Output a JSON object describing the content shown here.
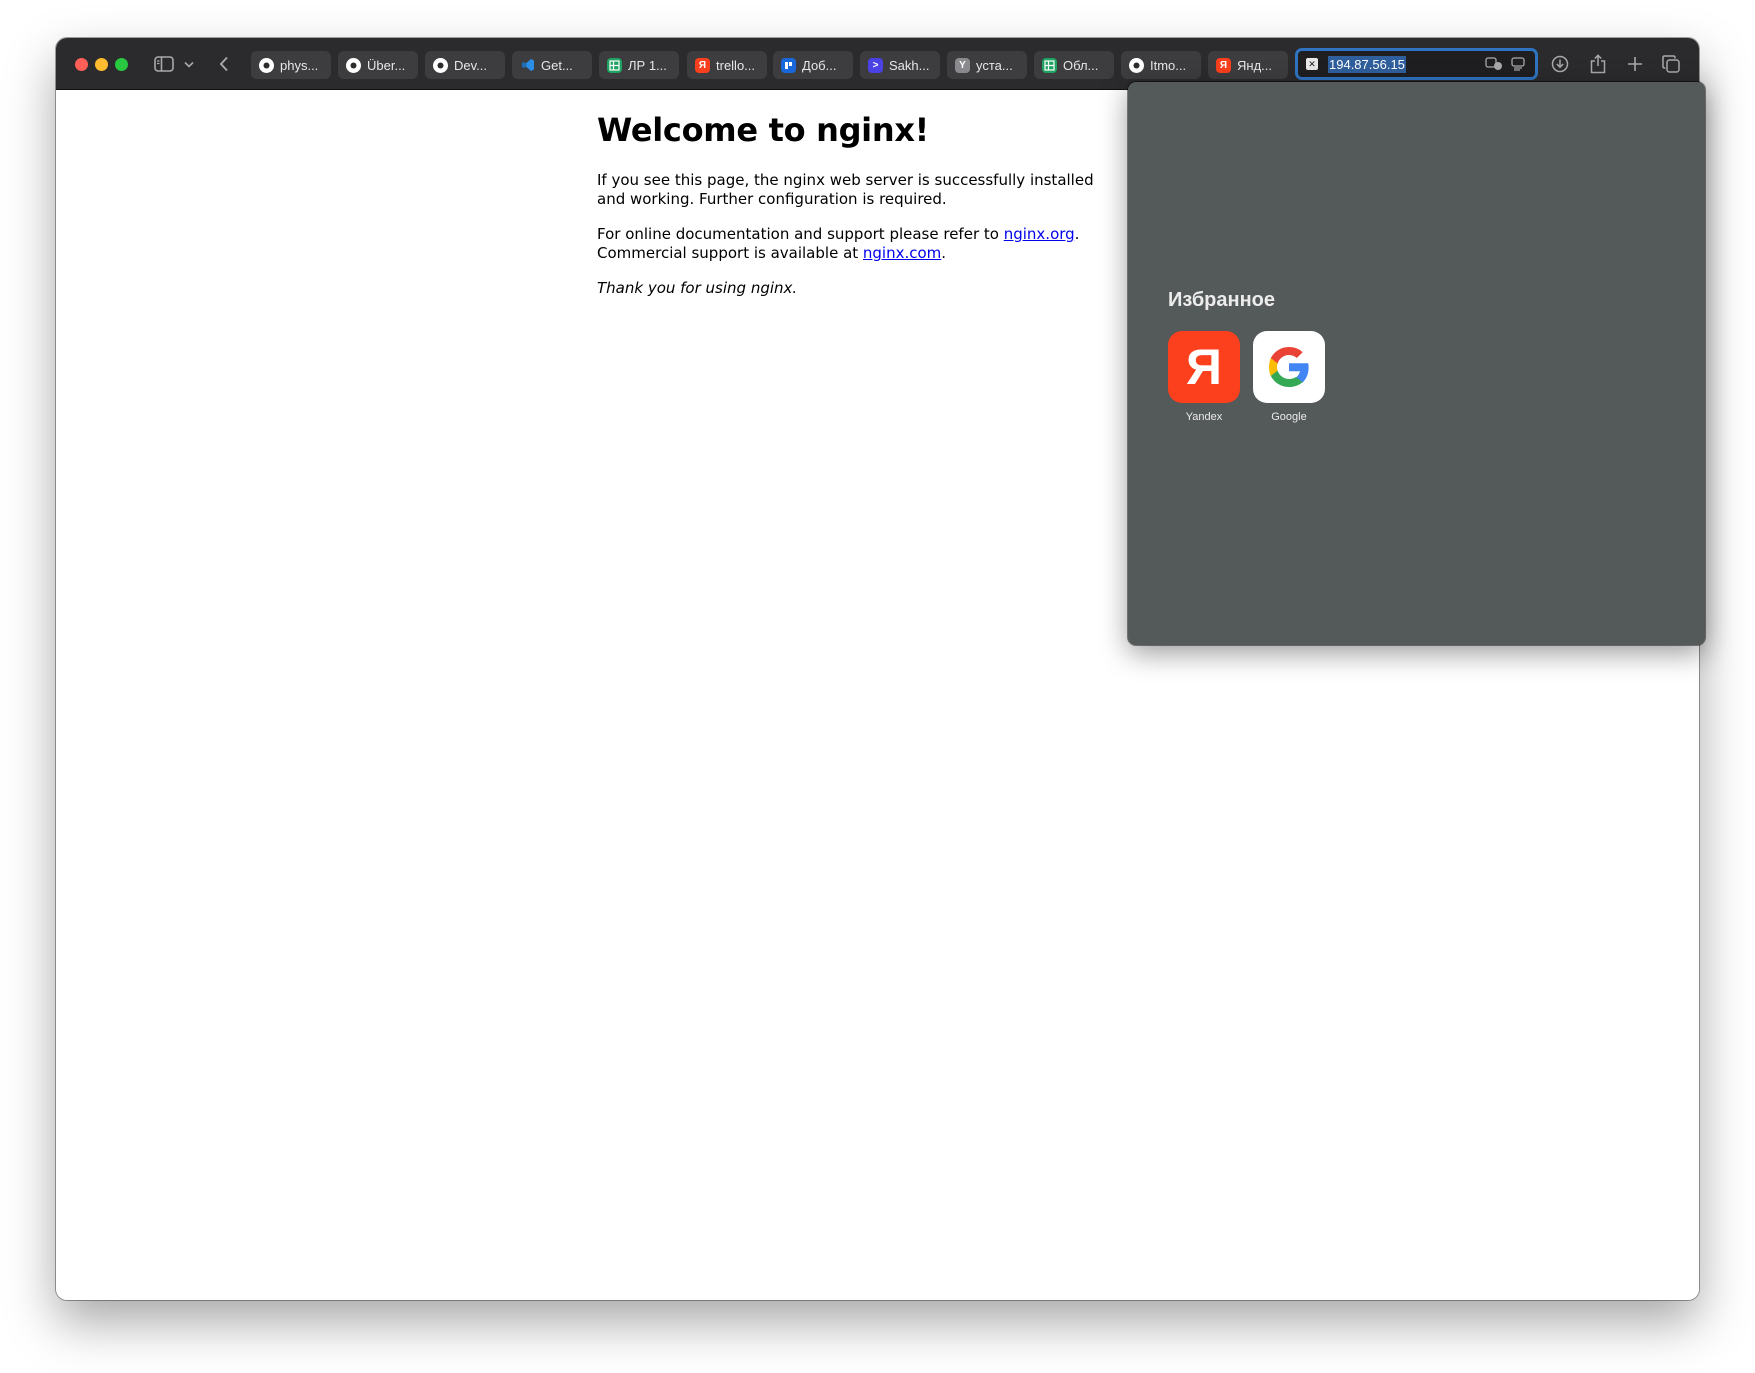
{
  "browser": {
    "tabs": [
      {
        "title": "phys...",
        "icon": "chatgpt-icon",
        "fav_color": "#ffffff",
        "fav_text": ""
      },
      {
        "title": "Über...",
        "icon": "openai-icon",
        "fav_color": "#ffffff",
        "fav_text": ""
      },
      {
        "title": "Dev...",
        "icon": "github-icon",
        "fav_color": "#ffffff",
        "fav_text": ""
      },
      {
        "title": "Get...",
        "icon": "vscode-icon",
        "fav_color": "#2b8ee6",
        "fav_text": ""
      },
      {
        "title": "ЛР 1...",
        "icon": "sheets-icon",
        "fav_color": "#1ea362",
        "fav_text": ""
      },
      {
        "title": "trello...",
        "icon": "yandex-icon",
        "fav_color": "#fc3f1d",
        "fav_text": "Я"
      },
      {
        "title": "Доб...",
        "icon": "trello-icon",
        "fav_color": "#1868db",
        "fav_text": ""
      },
      {
        "title": "Sakh...",
        "icon": "terminal-icon",
        "fav_color": "#4b42e6",
        "fav_text": ">"
      },
      {
        "title": "уста...",
        "icon": "letter-y-icon",
        "fav_color": "#8a8a8e",
        "fav_text": "Y"
      },
      {
        "title": "Обл...",
        "icon": "sheets-icon",
        "fav_color": "#1ea362",
        "fav_text": ""
      },
      {
        "title": "Itmo...",
        "icon": "github-icon",
        "fav_color": "#ffffff",
        "fav_text": ""
      },
      {
        "title": "Янд...",
        "icon": "yandex-icon",
        "fav_color": "#fc3f1d",
        "fav_text": "Я"
      }
    ],
    "url": "194.87.56.15",
    "accent": "#2f74c2"
  },
  "page": {
    "heading": "Welcome to nginx!",
    "p1": "If you see this page, the nginx web server is successfully installed and working. Further configuration is required.",
    "p2_prefix": "For online documentation and support please refer to ",
    "p2_link": "nginx.org",
    "p2_mid": ".",
    "p2_line2": "Commercial support is available at ",
    "p2_link2": "nginx.com",
    "p2_end": ".",
    "p3": "Thank you for using nginx."
  },
  "favorites": {
    "heading": "Избранное",
    "items": [
      {
        "label": "Yandex",
        "glyph": "Я",
        "bg": "#fc3f1d"
      },
      {
        "label": "Google",
        "glyph": "G",
        "bg": "#ffffff"
      }
    ]
  }
}
